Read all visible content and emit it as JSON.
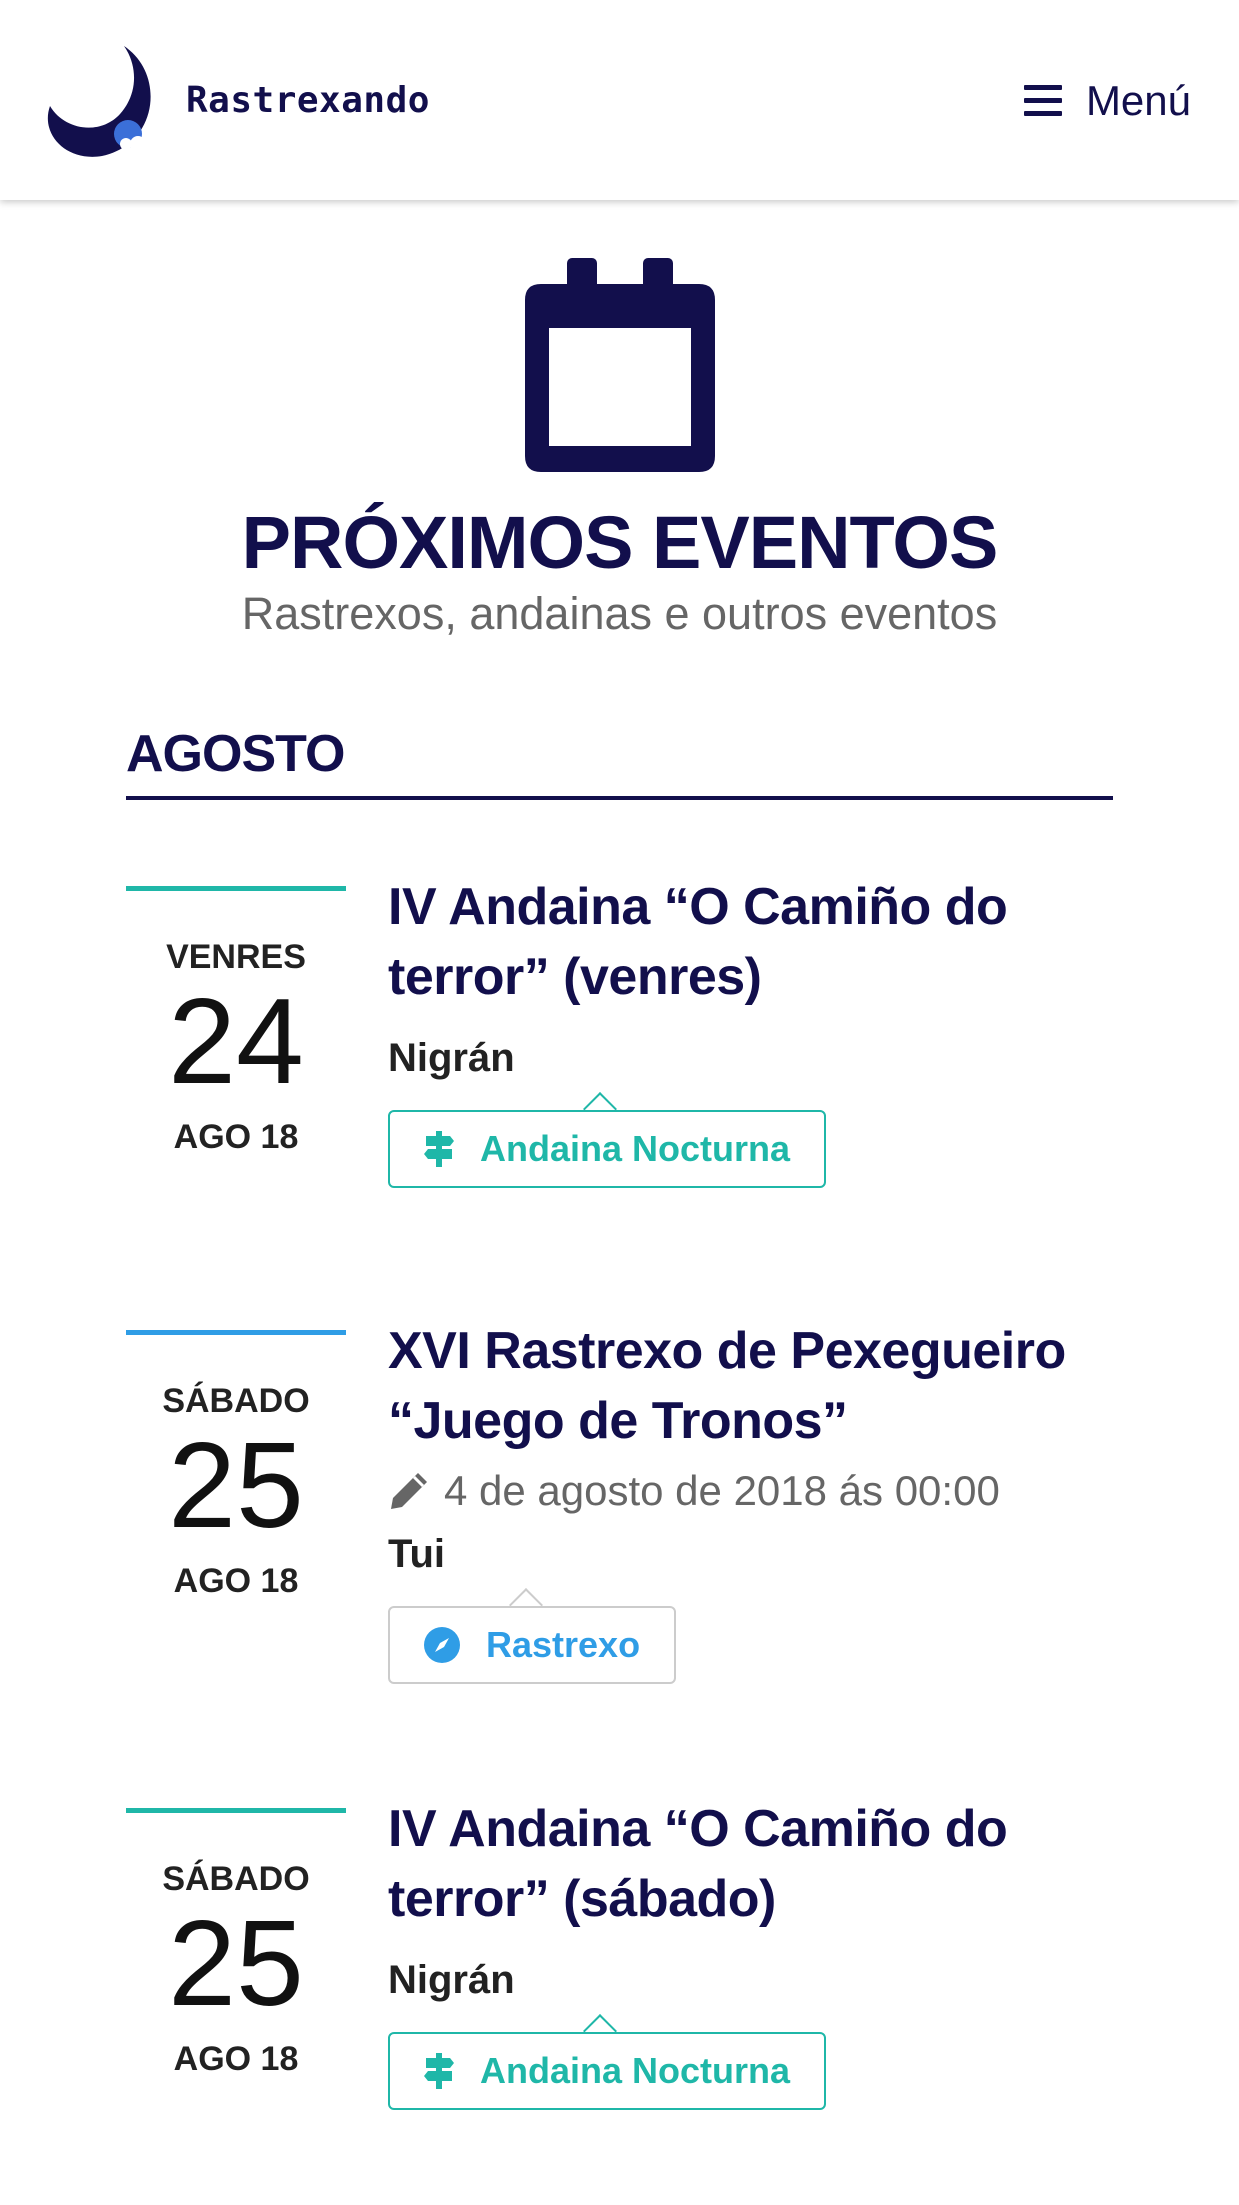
{
  "header": {
    "brand": "Rastrexando",
    "menu_label": "Menú"
  },
  "hero": {
    "title": "PRÓXIMOS EVENTOS",
    "subtitle": "Rastrexos, andainas e outros eventos"
  },
  "month": "AGOSTO",
  "colors": {
    "navy": "#120f4c",
    "teal": "#1fb7a8",
    "blue": "#2f9de6"
  },
  "events": [
    {
      "weekday": "VENRES",
      "day": "24",
      "month_year": "AGO 18",
      "title_line1": "IV Andaina “O Camiño do",
      "title_line2": "terror” (venres)",
      "meta": "",
      "location": "Nigrán",
      "tag": "Andaina Nocturna",
      "tag_icon": "signpost-icon"
    },
    {
      "weekday": "SÁBADO",
      "day": "25",
      "month_year": "AGO 18",
      "title_line1": "XVI Rastrexo de Pexegueiro",
      "title_line2": "“Juego de Tronos”",
      "meta": "4 de agosto de 2018 ás 00:00",
      "meta_icon": "pencil-icon",
      "location": "Tui",
      "tag": "Rastrexo",
      "tag_icon": "compass-icon"
    },
    {
      "weekday": "SÁBADO",
      "day": "25",
      "month_year": "AGO 18",
      "title_line1": "IV Andaina “O Camiño do",
      "title_line2": "terror” (sábado)",
      "meta": "",
      "location": "Nigrán",
      "tag": "Andaina Nocturna",
      "tag_icon": "signpost-icon"
    }
  ]
}
